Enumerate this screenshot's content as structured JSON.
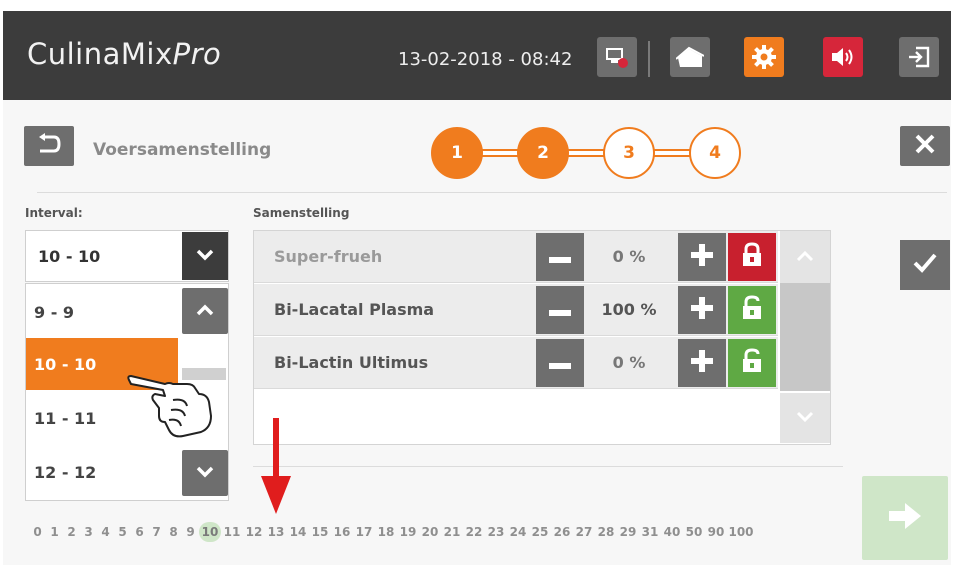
{
  "app": {
    "name": "CulinaMix",
    "name_suffix": "Pro"
  },
  "header": {
    "datetime": "13-02-2018 - 08:42",
    "icons": [
      "display-record-icon",
      "home-icon",
      "settings-gear-icon",
      "speaker-icon",
      "logout-icon"
    ],
    "colors": {
      "bar": "#3c3c3c",
      "settings": "#f07c1e",
      "speaker": "#d6263a"
    }
  },
  "wizard": {
    "title": "Voersamenstelling",
    "steps": [
      "1",
      "2",
      "3",
      "4"
    ],
    "completed_steps": 2
  },
  "interval": {
    "label": "Interval:",
    "selected": "10 - 10",
    "options": [
      "9 - 9",
      "10 - 10",
      "11 - 11",
      "12 - 12"
    ],
    "highlighted": "10 - 10"
  },
  "composition": {
    "label": "Samenstelling",
    "rows": [
      {
        "name": "Super-frueh",
        "percent": "0 %",
        "lock": "locked",
        "lock_color": "#c8202e"
      },
      {
        "name": "Bi-Lacatal Plasma",
        "percent": "100 %",
        "lock": "unlocked",
        "lock_color": "#5fa944"
      },
      {
        "name": "Bi-Lactin Ultimus",
        "percent": "0 %",
        "lock": "unlocked",
        "lock_color": "#5fa944"
      }
    ]
  },
  "timeline": {
    "labels": [
      "0",
      "1",
      "2",
      "3",
      "4",
      "5",
      "6",
      "7",
      "8",
      "9",
      "10",
      "11",
      "12",
      "13",
      "14",
      "15",
      "16",
      "17",
      "18",
      "19",
      "20",
      "21",
      "22",
      "23",
      "24",
      "25",
      "26",
      "27",
      "28",
      "29",
      "31",
      "40",
      "50",
      "90",
      "100"
    ],
    "current": "10"
  },
  "accent": "#f07c1e"
}
